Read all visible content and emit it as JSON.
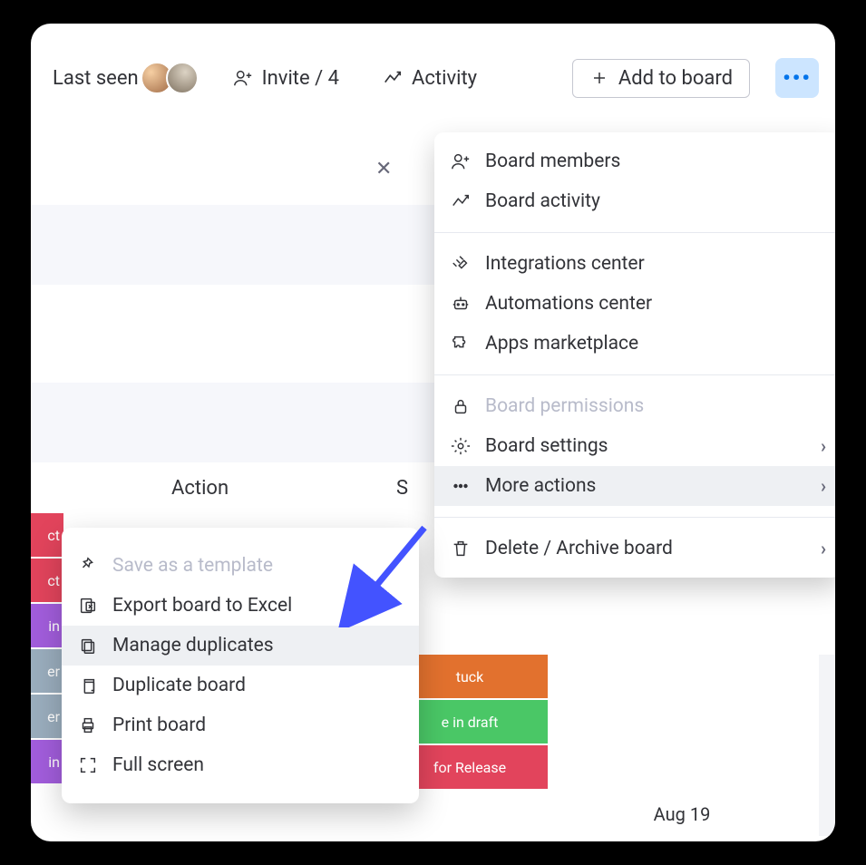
{
  "header": {
    "last_seen": "Last seen",
    "invite": "Invite / 4",
    "activity": "Activity",
    "add_to_board": "Add to board"
  },
  "columns": {
    "action": "Action",
    "s": "S"
  },
  "menuA": [
    {
      "k": "board-members",
      "icon": "person-plus",
      "label": "Board members"
    },
    {
      "k": "board-activity",
      "icon": "activity",
      "label": "Board activity"
    },
    {
      "sep": true
    },
    {
      "k": "integrations",
      "icon": "plug",
      "label": "Integrations center"
    },
    {
      "k": "automations",
      "icon": "robot",
      "label": "Automations center"
    },
    {
      "k": "apps",
      "icon": "puzzle",
      "label": "Apps marketplace"
    },
    {
      "sep": true
    },
    {
      "k": "permissions",
      "icon": "lock",
      "label": "Board permissions",
      "disabled": true
    },
    {
      "k": "settings",
      "icon": "gear",
      "label": "Board settings",
      "chev": true
    },
    {
      "k": "more",
      "icon": "dots",
      "label": "More actions",
      "chev": true,
      "highlight": true
    },
    {
      "sep": true
    },
    {
      "k": "delete",
      "icon": "trash",
      "label": "Delete / Archive board",
      "chev": true
    }
  ],
  "menuB": [
    {
      "k": "save-template",
      "icon": "pin",
      "label": "Save as a template",
      "disabled": true
    },
    {
      "k": "export-excel",
      "icon": "excel",
      "label": "Export board to Excel"
    },
    {
      "k": "manage-dup",
      "icon": "copies",
      "label": "Manage duplicates",
      "highlight": true
    },
    {
      "k": "dup-board",
      "icon": "copy",
      "label": "Duplicate board"
    },
    {
      "k": "print",
      "icon": "print",
      "label": "Print board"
    },
    {
      "k": "full",
      "icon": "expand",
      "label": "Full screen"
    }
  ],
  "left_pills": [
    {
      "t": "ct",
      "c": "#e2445c"
    },
    {
      "t": "ct",
      "c": "#e2445c"
    },
    {
      "t": "in",
      "c": "#a25ddc"
    },
    {
      "t": "er",
      "c": "#9aadbd"
    },
    {
      "t": "er",
      "c": "#9aadbd"
    },
    {
      "t": "in",
      "c": "#a25ddc"
    }
  ],
  "status": [
    {
      "t": "tuck",
      "c": "#e2712e"
    },
    {
      "t": "e in draft",
      "c": "#4ac766"
    },
    {
      "t": "for Release",
      "c": "#e2445c"
    }
  ],
  "date": "Aug 19",
  "icons": {}
}
